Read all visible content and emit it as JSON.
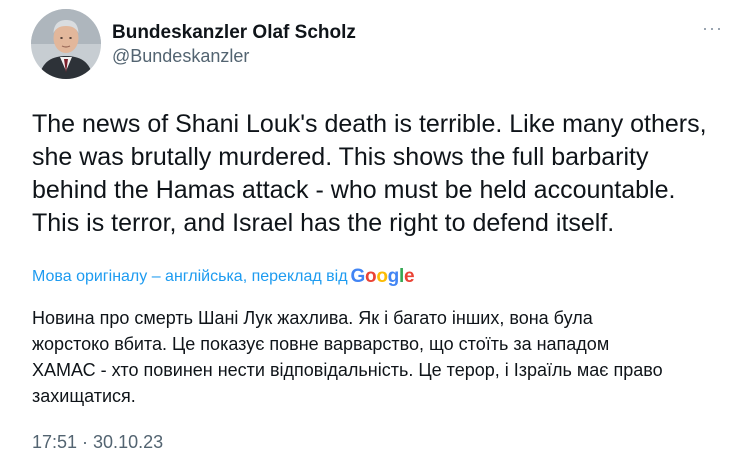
{
  "author": {
    "name": "Bundeskanzler Olaf Scholz",
    "handle": "@Bundeskanzler"
  },
  "more_button": {
    "glyph": "···"
  },
  "tweet": {
    "text": "The news of Shani Louk's death is terrible. Like many others,\nshe was brutally murdered. This shows the full barbarity\nbehind the Hamas attack - who must be held accountable.\nThis is terror, and Israel has the right to defend itself."
  },
  "translation": {
    "note": "Мова оригіналу – англійська, переклад від",
    "provider_letters": [
      "G",
      "o",
      "o",
      "g",
      "l",
      "e"
    ],
    "text": "Новина про смерть Шані Лук жахлива. Як і багато інших, вона була\nжорстоко вбита. Це показує повне варварство, що стоїть за нападом\nХАМАС - хто повинен нести відповідальність. Це терор, і Ізраїль має право\nзахищатися."
  },
  "timestamp": "17:51 · 30.10.23",
  "colors": {
    "link": "#1d9bf0",
    "secondary": "#536471",
    "text": "#0f1419"
  },
  "icons": {
    "avatar": "profile-photo",
    "more": "ellipsis-icon"
  }
}
